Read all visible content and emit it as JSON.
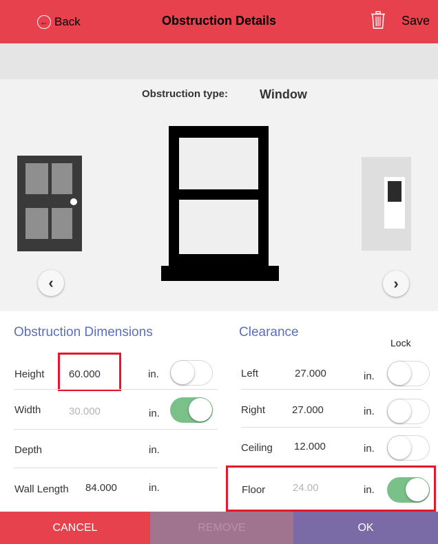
{
  "header": {
    "back_label": "Back",
    "title": "Obstruction Details",
    "save_label": "Save",
    "back_icon": "back-arrow-circle-icon",
    "delete_icon": "trash-icon"
  },
  "picker": {
    "type_label": "Obstruction type:",
    "type_value": "Window",
    "prev_icon": "chevron-left-icon",
    "next_icon": "chevron-right-icon",
    "prev_glyph": "‹",
    "next_glyph": "›"
  },
  "dimensions": {
    "title": "Obstruction Dimensions",
    "rows": [
      {
        "label": "Height",
        "value": "60.000",
        "unit": "in.",
        "locked": false,
        "highlighted": true
      },
      {
        "label": "Width",
        "value": "30.000",
        "unit": "in.",
        "locked": true
      },
      {
        "label": "Depth",
        "value": "",
        "unit": "in."
      },
      {
        "label": "Wall Length",
        "value": "84.000",
        "unit": "in."
      }
    ]
  },
  "clearance": {
    "title": "Clearance",
    "lock_label": "Lock",
    "rows": [
      {
        "label": "Left",
        "value": "27.000",
        "unit": "in.",
        "locked": false
      },
      {
        "label": "Right",
        "value": "27.000",
        "unit": "in.",
        "locked": false
      },
      {
        "label": "Ceiling",
        "value": "12.000",
        "unit": "in.",
        "locked": false
      },
      {
        "label": "Floor",
        "value": "24.00",
        "unit": "in.",
        "locked": true,
        "highlighted": true
      }
    ]
  },
  "footer": {
    "cancel_label": "CANCEL",
    "remove_label": "REMOVE",
    "ok_label": "OK"
  },
  "colors": {
    "header": "#e8414e",
    "accent_blue": "#5b6ebf",
    "toggle_on": "#7ac189",
    "ok_button": "#7a6aa6",
    "remove_button": "#a0738f",
    "highlight": "#e3182d"
  }
}
